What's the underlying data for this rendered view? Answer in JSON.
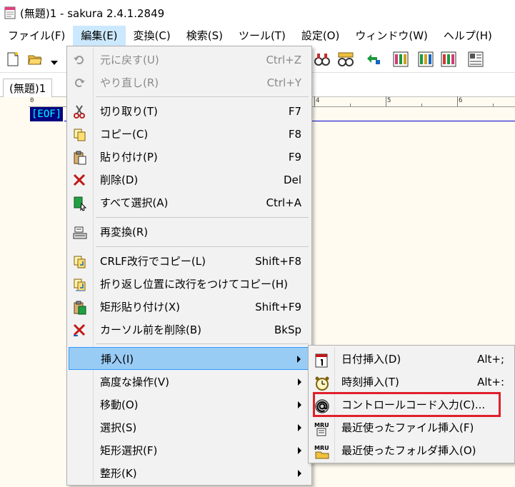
{
  "window": {
    "title": "(無題)1 - sakura 2.4.1.2849"
  },
  "menubar": [
    {
      "label": "ファイル(F)",
      "active": false
    },
    {
      "label": "編集(E)",
      "active": true
    },
    {
      "label": "変換(C)",
      "active": false
    },
    {
      "label": "検索(S)",
      "active": false
    },
    {
      "label": "ツール(T)",
      "active": false
    },
    {
      "label": "設定(O)",
      "active": false
    },
    {
      "label": "ウィンドウ(W)",
      "active": false
    },
    {
      "label": "ヘルプ(H)",
      "active": false
    }
  ],
  "tab": {
    "label": "(無題)1"
  },
  "editor": {
    "ruler_zero": "0",
    "ruler_labels": [
      "4",
      "5",
      "6"
    ],
    "eof_marker": "[EOF]"
  },
  "edit_menu": {
    "items": [
      {
        "label": "元に戻す(U)",
        "shortcut": "Ctrl+Z",
        "icon": "undo-icon",
        "disabled": true
      },
      {
        "label": "やり直し(R)",
        "shortcut": "Ctrl+Y",
        "icon": "redo-icon",
        "disabled": true
      },
      {
        "label": "切り取り(T)",
        "shortcut": "F7",
        "icon": "scissors-icon"
      },
      {
        "label": "コピー(C)",
        "shortcut": "F8",
        "icon": "copy-icon"
      },
      {
        "label": "貼り付け(P)",
        "shortcut": "F9",
        "icon": "paste-icon"
      },
      {
        "label": "削除(D)",
        "shortcut": "Del",
        "icon": "delete-x-icon"
      },
      {
        "label": "すべて選択(A)",
        "shortcut": "Ctrl+A",
        "icon": "select-all-icon"
      },
      {
        "label": "再変換(R)",
        "shortcut": "",
        "icon": "reconvert-icon"
      },
      {
        "label": "CRLF改行でコピー(L)",
        "shortcut": "Shift+F8",
        "icon": "copy-crlf-icon"
      },
      {
        "label": "折り返し位置に改行をつけてコピー(H)",
        "shortcut": "",
        "icon": "copy-wrap-icon"
      },
      {
        "label": "矩形貼り付け(X)",
        "shortcut": "Shift+F9",
        "icon": "box-paste-icon"
      },
      {
        "label": "カーソル前を削除(B)",
        "shortcut": "BkSp",
        "icon": "backspace-x-icon"
      },
      {
        "label": "挿入(I)",
        "submenu": true
      },
      {
        "label": "高度な操作(V)",
        "submenu": true
      },
      {
        "label": "移動(O)",
        "submenu": true
      },
      {
        "label": "選択(S)",
        "submenu": true
      },
      {
        "label": "矩形選択(F)",
        "submenu": true
      },
      {
        "label": "整形(K)",
        "submenu": true
      }
    ]
  },
  "insert_submenu": {
    "items": [
      {
        "label": "日付挿入(D)",
        "shortcut": "Alt+;",
        "icon": "calendar-icon"
      },
      {
        "label": "時刻挿入(T)",
        "shortcut": "Alt+:",
        "icon": "clock-icon"
      },
      {
        "label": "コントロールコード入力(C)...",
        "shortcut": "",
        "icon": "at-sign-icon",
        "highlighted_box": true
      },
      {
        "label": "最近使ったファイル挿入(F)",
        "shortcut": "",
        "icon": "mru-file-icon"
      },
      {
        "label": "最近使ったフォルダ挿入(O)",
        "shortcut": "",
        "icon": "mru-folder-icon"
      }
    ],
    "icon_text": "MRU"
  },
  "colors": {
    "menu_highlight": "#99ccf5",
    "menubar_active": "#cce8ff",
    "callout_red": "#e0202a",
    "editor_bg": "#fffbf0",
    "eof_bg": "#000080",
    "eof_fg": "#00ffff"
  }
}
